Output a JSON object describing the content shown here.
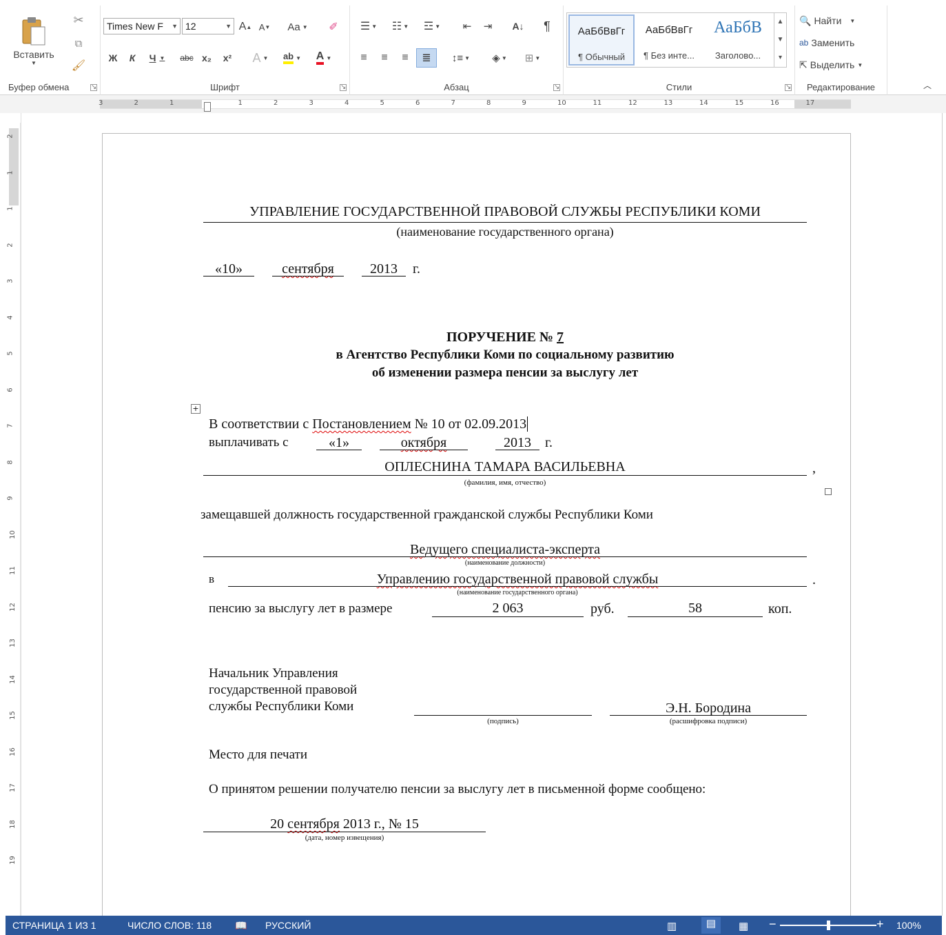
{
  "ribbon": {
    "clipboard": {
      "paste_label": "Вставить",
      "group_label": "Буфер обмена"
    },
    "font": {
      "font_name": "Times New F",
      "font_size": "12",
      "bold": "Ж",
      "italic": "К",
      "underline": "Ч",
      "strike": "abc",
      "sub": "x₂",
      "sup": "x²",
      "case": "Aa",
      "group_label": "Шрифт"
    },
    "paragraph": {
      "group_label": "Абзац"
    },
    "styles": {
      "items": [
        {
          "preview": "АаБбВвГг",
          "name": "¶ Обычный"
        },
        {
          "preview": "АаБбВвГг",
          "name": "¶ Без инте..."
        },
        {
          "preview": "АаБбВ",
          "name": "Заголово..."
        }
      ],
      "group_label": "Стили"
    },
    "editing": {
      "find": "Найти",
      "replace": "Заменить",
      "select": "Выделить",
      "group_label": "Редактирование"
    }
  },
  "ruler": {
    "h_ticks": [
      "3",
      "2",
      "1",
      "1",
      "2",
      "3",
      "4",
      "5",
      "6",
      "7",
      "8",
      "9",
      "10",
      "11",
      "12",
      "13",
      "14",
      "15",
      "16",
      "17"
    ],
    "v_ticks": [
      "2",
      "1",
      "1",
      "2",
      "3",
      "4",
      "5",
      "6",
      "7",
      "8",
      "9",
      "10",
      "11",
      "12",
      "13",
      "14",
      "15",
      "16",
      "17",
      "18",
      "19"
    ],
    "tab_symbol": "L"
  },
  "document": {
    "org_name": "УПРАВЛЕНИЕ ГОСУДАРСТВЕННОЙ ПРАВОВОЙ СЛУЖБЫ РЕСПУБЛИКИ КОМИ",
    "org_caption": "(наименование государственного органа)",
    "date_day": "«10»",
    "date_month": "сентября",
    "date_year": "2013",
    "date_g": "г.",
    "title_line1_prefix": "ПОРУЧЕНИЕ № ",
    "title_number": "7",
    "title_line2": "в Агентство Республики Коми по социальному развитию",
    "title_line3": "об изменении размера пенсии за выслугу лет",
    "basis_prefix": "В соответствии с ",
    "basis_word": "Постановлением",
    "basis_suffix": " № 10 от 02.09.2013",
    "pay_from": "выплачивать с",
    "pay_day": "«1»",
    "pay_month": "октября",
    "pay_year": "2013",
    "pay_g": "г.",
    "person_name": "ОПЛЕСНИНА ТАМАРА ВАСИЛЬЕВНА",
    "person_comma": ",",
    "person_caption": "(фамилия, имя, отчество)",
    "position_intro": "замещавшей должность государственной гражданской службы Республики Коми",
    "position_name": "Ведущего специалиста-эксперта",
    "position_caption": "(наименование должности)",
    "in_label": "в",
    "dept_name": "Управлению государственной правовой службы",
    "dept_dot": ".",
    "dept_caption": "(наименование государственного органа)",
    "pension_label": "пенсию за выслугу лет в размере",
    "pension_rub": "2 063",
    "rub_label": "руб.",
    "pension_kop": "58",
    "kop_label": "коп.",
    "chief_line1": "Начальник Управления",
    "chief_line2": "государственной правовой",
    "chief_line3": "службы Республики Коми",
    "signature_caption": "(подпись)",
    "signer_name": "Э.Н. Бородина",
    "signer_caption": "(расшифровка подписи)",
    "stamp_place": "Место для печати",
    "notice_text": "О принятом решении получателю пенсии за выслугу лет в письменной форме сообщено:",
    "notice_value_a": "20 ",
    "notice_value_b": "сентября",
    "notice_value_c": " 2013  г., № 15",
    "notice_caption": "(дата, номер извещения)"
  },
  "status": {
    "page": "СТРАНИЦА 1 ИЗ 1",
    "words": "ЧИСЛО СЛОВ: 118",
    "language": "РУССКИЙ",
    "zoom": "100%",
    "zoom_level_percent": 100
  },
  "colors": {
    "accent": "#2b579a",
    "font_color_red": "#e81123",
    "highlight_yellow": "#ffef00",
    "spell_error": "#d00000"
  }
}
